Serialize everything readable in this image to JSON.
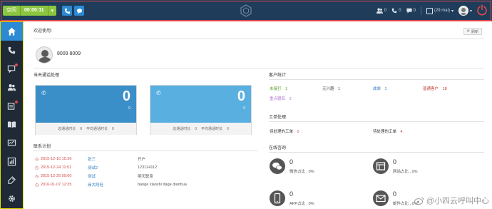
{
  "topbar": {
    "status_label": "空闲",
    "timer": "00:00:11",
    "caret": "▾",
    "phone_icon": "phone-icon",
    "chat_icon": "chat-bubble-icon",
    "right": {
      "users_count": "0",
      "calls_count": "0",
      "messages_count": "0",
      "mail_label": "(29 mai)",
      "mail_caret": "▾",
      "user_caret": "▾"
    },
    "colors": {
      "bg": "#1f3c5a",
      "status_green": "#8cc63f",
      "icon_blue": "#2b8ad3",
      "power_red": "#e04848"
    }
  },
  "sidebar": {
    "items": [
      {
        "icon": "home-icon",
        "active": true
      },
      {
        "icon": "phone-icon"
      },
      {
        "icon": "sms-icon",
        "badge": true
      },
      {
        "icon": "customers-icon"
      },
      {
        "icon": "workorder-icon",
        "badge": true
      },
      {
        "icon": "knowledge-book-icon"
      },
      {
        "icon": "monitor-icon"
      },
      {
        "icon": "report-chart-icon"
      },
      {
        "icon": "tag-icon"
      },
      {
        "icon": "settings-gear-icon"
      }
    ]
  },
  "main": {
    "welcome": "欢迎使用!",
    "refresh_label": "刷新",
    "user": {
      "name": "8009  8009"
    },
    "calls_section": {
      "title": "当天通话处理",
      "cards": [
        {
          "big": "0",
          "small": "0",
          "total_label": "总通话时长",
          "total_value": "0",
          "avg_label": "平均通话时长",
          "avg_value": "0"
        },
        {
          "big": "0",
          "small": "0",
          "total_label": "总通话时长",
          "total_value": "0",
          "avg_label": "平均通话时长",
          "avg_value": "0"
        }
      ]
    },
    "plan_section": {
      "title": "联系计划",
      "rows": [
        {
          "date": "2015-12-10 15:36",
          "name": "张三",
          "note": "开户"
        },
        {
          "date": "2015-12-24 11:51",
          "name": "测试2",
          "note": "123124112"
        },
        {
          "date": "2015-12-25 09:00",
          "name": "测试",
          "note": "明天联系"
        },
        {
          "date": "2016-01-07 12:35",
          "name": "商大阿旺",
          "note": "bange xiaoshi dage dianhua"
        }
      ]
    },
    "customer_stats": {
      "title": "客户统计",
      "items": [
        {
          "label": "未接打",
          "value": "1",
          "color": "#5aa02c"
        },
        {
          "label": "无兴趣",
          "value": "1",
          "color": "#555555"
        },
        {
          "label": "成单",
          "value": "1",
          "color": "#2b7bc2"
        },
        {
          "label": "普通客户",
          "value": "18",
          "color": "#c0392b"
        },
        {
          "label": "重点跟踪",
          "value": "3",
          "color": "#b57bd6"
        }
      ]
    },
    "workorder_stats": {
      "title": "工单处理",
      "items": [
        {
          "label": "待处理的工单",
          "value": "0",
          "value_color": "#d24a4a"
        },
        {
          "label": "待处理的工单",
          "value": "4",
          "value_color": "#d24a4a"
        }
      ]
    },
    "online_section": {
      "title": "在线咨询",
      "channels": [
        {
          "icon": "wechat-icon",
          "value": "0",
          "label": "微信占比 , 0%"
        },
        {
          "icon": "website-icon",
          "value": "0",
          "label": "网站占比 , 0%"
        },
        {
          "icon": "mobile-app-icon",
          "value": "0",
          "label": "APP占比 , 0%"
        },
        {
          "icon": "email-icon",
          "value": "0",
          "label": "邮件占比 , 0%"
        }
      ]
    }
  },
  "watermark": {
    "icon": "weibo-icon",
    "text": "@小四云呼叫中心"
  }
}
